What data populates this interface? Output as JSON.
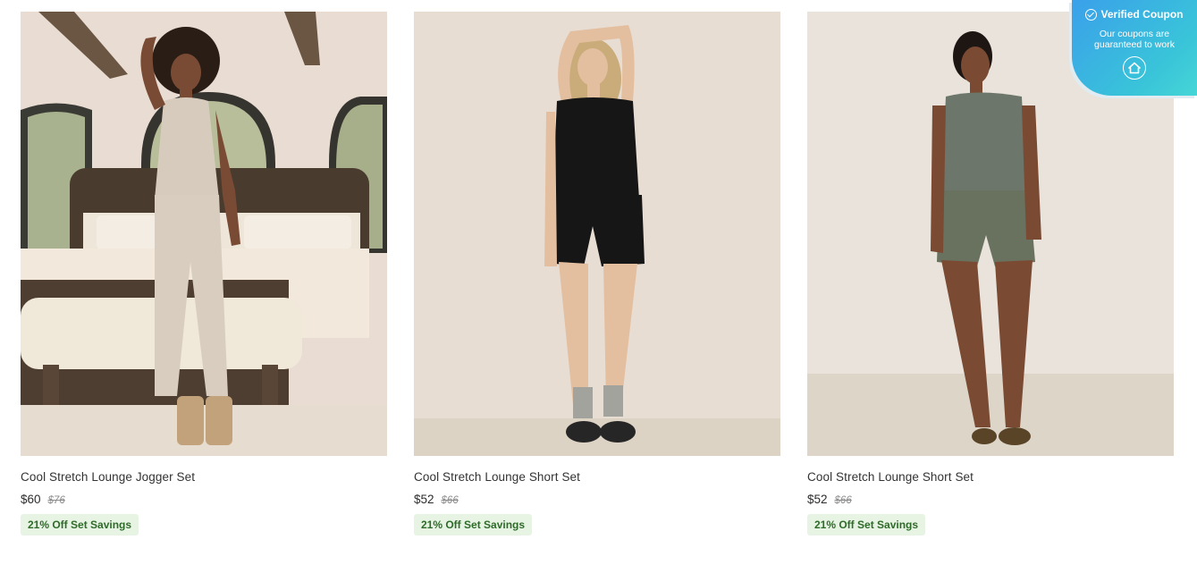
{
  "products": [
    {
      "title": "Cool Stretch Lounge Jogger Set",
      "price": "$60",
      "original_price": "$76",
      "badge": "21% Off Set Savings"
    },
    {
      "title": "Cool Stretch Lounge Short Set",
      "price": "$52",
      "original_price": "$66",
      "badge": "21% Off Set Savings"
    },
    {
      "title": "Cool Stretch Lounge Short Set",
      "price": "$52",
      "original_price": "$66",
      "badge": "21% Off Set Savings"
    }
  ],
  "coupon_tab": {
    "title": "Verified Coupon",
    "subtitle": "Our coupons are guaranteed to work",
    "icon": "house-logo-icon"
  },
  "colors": {
    "badge_bg": "#e7f4e4",
    "badge_text": "#2e6b28",
    "coupon_gradient_start": "#3aa0ea",
    "coupon_gradient_end": "#46d6d6"
  }
}
